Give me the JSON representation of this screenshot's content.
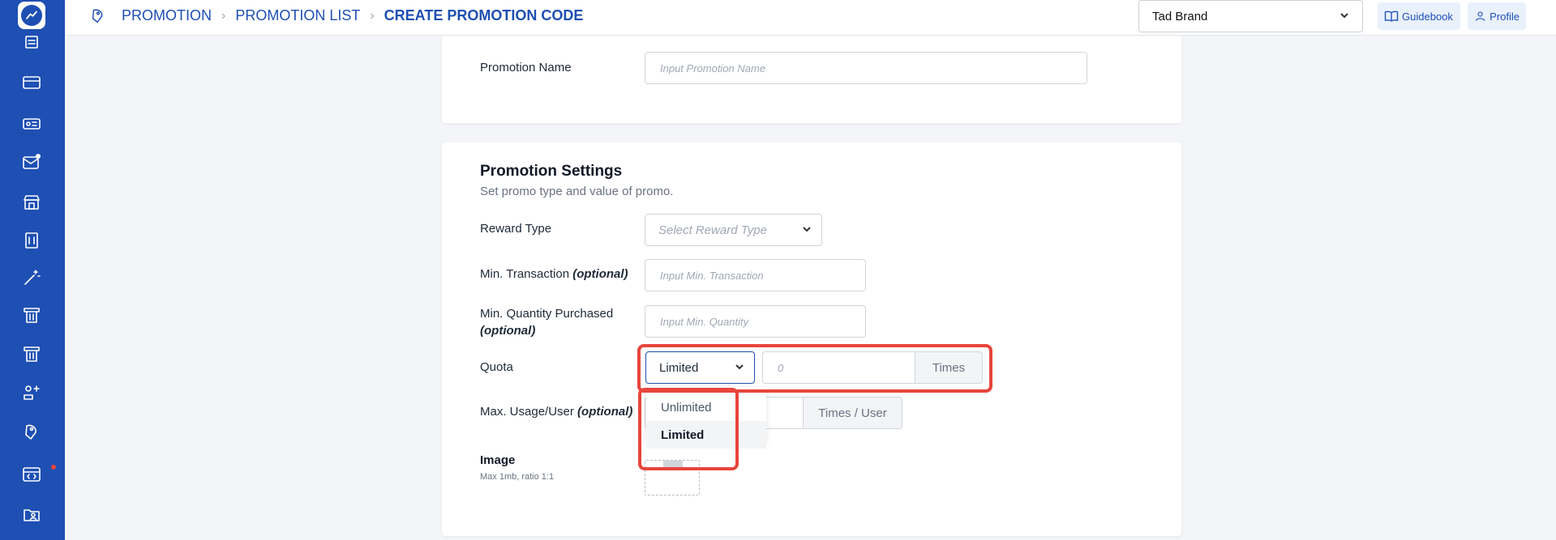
{
  "header": {
    "breadcrumb": [
      "PROMOTION",
      "PROMOTION LIST"
    ],
    "current_page": "CREATE PROMOTION CODE",
    "brand_select": "Tad Brand",
    "guidebook_label": "Guidebook",
    "profile_label": "Profile"
  },
  "promotion_name": {
    "label": "Promotion Name",
    "placeholder": "Input Promotion Name"
  },
  "settings": {
    "title": "Promotion Settings",
    "subtitle": "Set promo type and value of promo.",
    "reward_type": {
      "label": "Reward Type",
      "placeholder": "Select Reward Type"
    },
    "min_transaction": {
      "label": "Min. Transaction",
      "optional": "(optional)",
      "placeholder": "Input Min. Transaction"
    },
    "min_quantity": {
      "label": "Min. Quantity Purchased",
      "optional": "(optional)",
      "placeholder": "Input Min. Quantity"
    },
    "quota": {
      "label": "Quota",
      "selected": "Limited",
      "value_placeholder": "0",
      "unit": "Times"
    },
    "quota_options": [
      "Unlimited",
      "Limited"
    ],
    "max_usage": {
      "label": "Max. Usage/User",
      "optional": "(optional)",
      "unit": "Times / User"
    },
    "image": {
      "label": "Image",
      "hint": "Max 1mb, ratio 1:1"
    }
  },
  "colors": {
    "sidebar": "#1e4fb3",
    "highlight": "#e8453c",
    "accent": "#1e4fb3"
  },
  "sidebar_icons": [
    "document-icon",
    "card-icon",
    "voucher-icon",
    "mail-icon",
    "store-icon",
    "menu-icon",
    "magic-wand-icon",
    "ticket-icon",
    "ticket-icon-2",
    "users-add-icon",
    "tag-icon",
    "code-window-icon",
    "folder-user-icon"
  ]
}
